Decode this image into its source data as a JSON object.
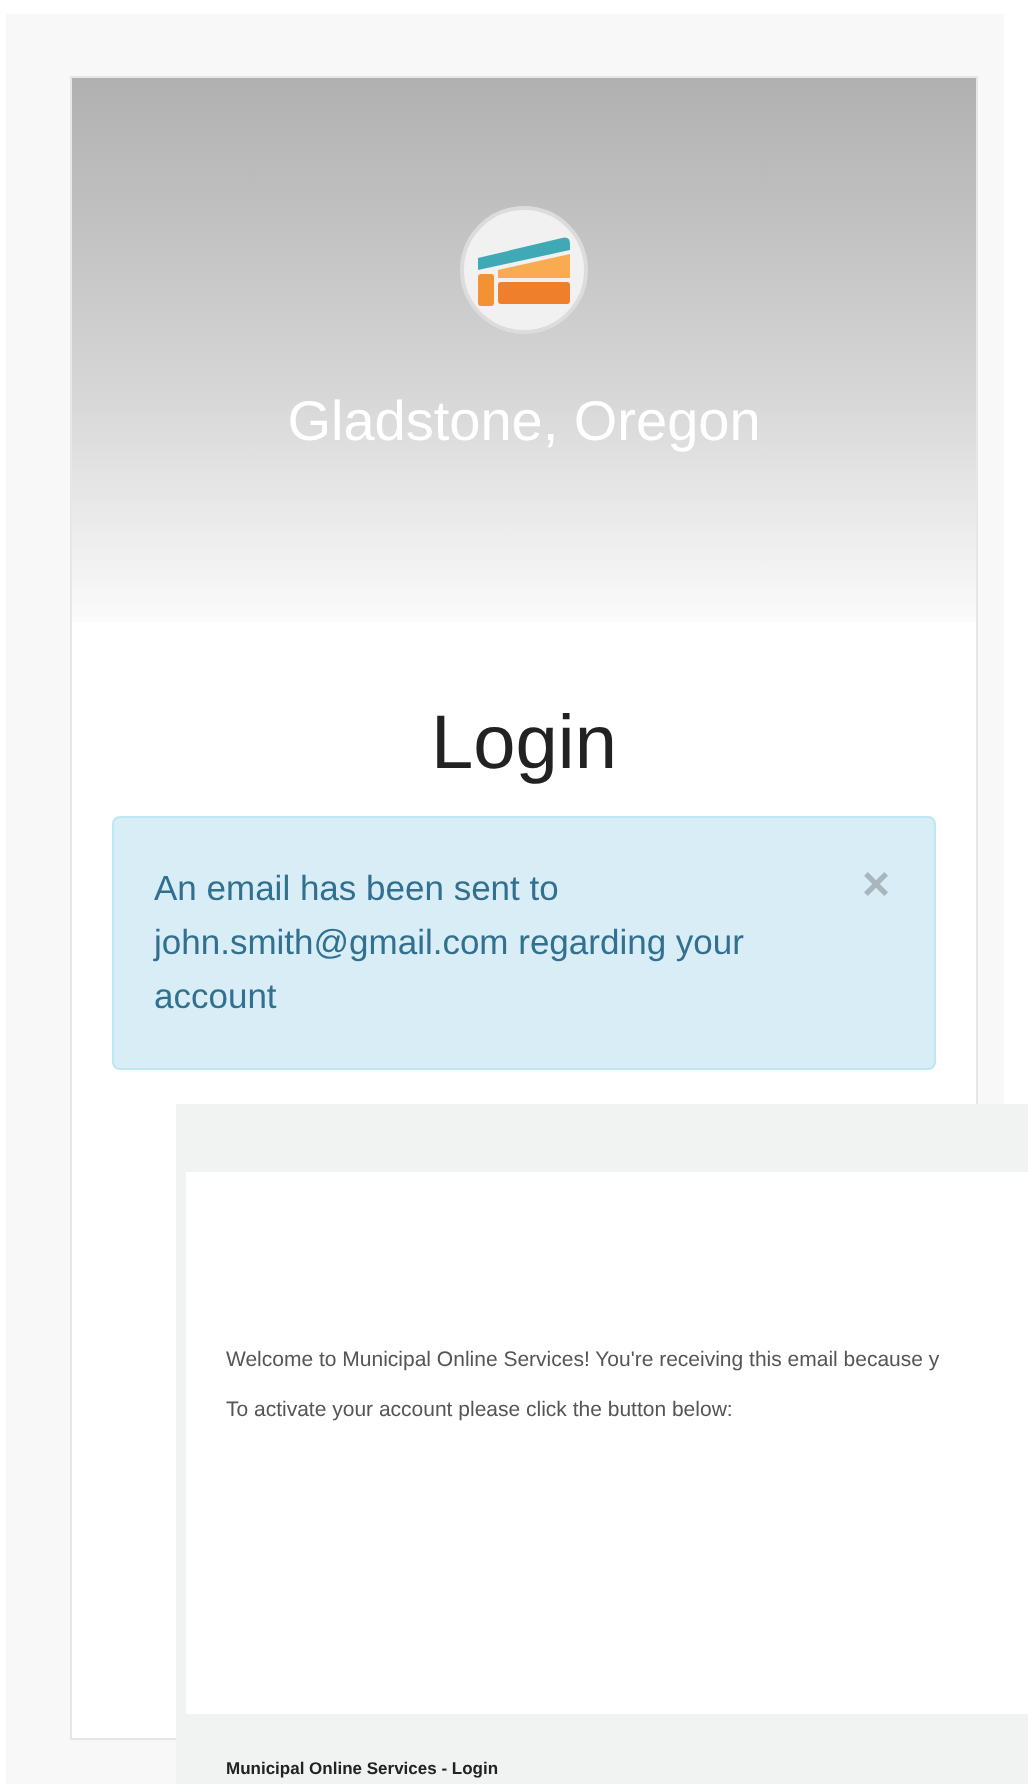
{
  "header": {
    "city": "Gladstone, Oregon"
  },
  "login": {
    "title": "Login"
  },
  "alert": {
    "message": "An email has been sent to john.smith@gmail.com regarding your account",
    "close": "×"
  },
  "email_preview": {
    "paragraphs": [
      "Welcome to Municipal Online Services! You're receiving this email because y",
      "To activate your account please click the button below:"
    ],
    "footer": "Municipal Online Services - Login"
  }
}
